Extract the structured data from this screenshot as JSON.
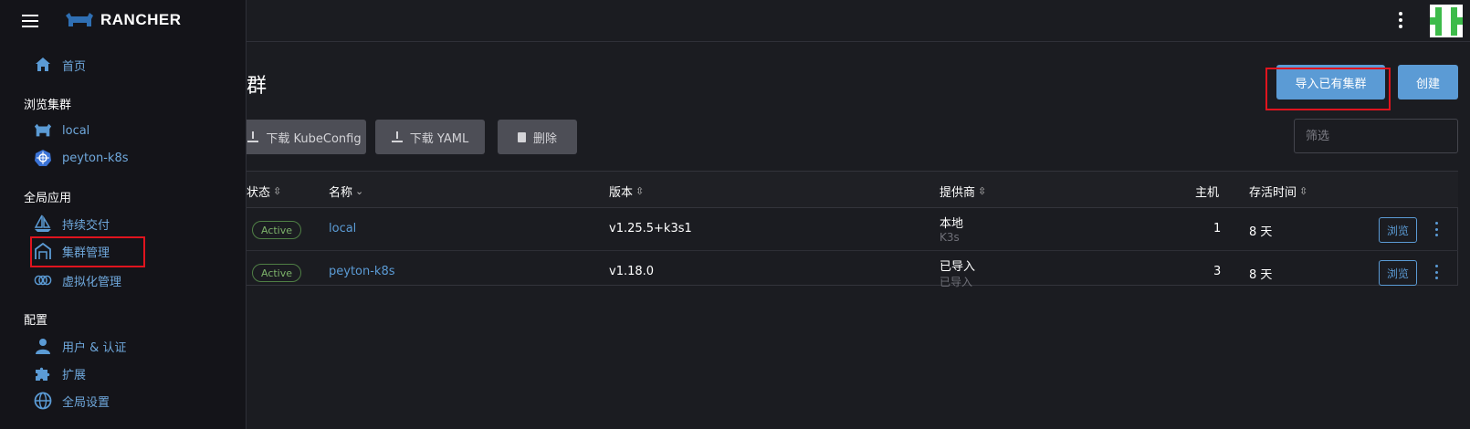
{
  "brand": {
    "logo_text": "RANCHER"
  },
  "sidebar": {
    "home": "首页",
    "groups": [
      {
        "label": "浏览集群",
        "items": [
          "local",
          "peyton-k8s"
        ]
      },
      {
        "label": "全局应用",
        "items": [
          "持续交付",
          "集群管理",
          "虚拟化管理"
        ]
      },
      {
        "label": "配置",
        "items": [
          "用户 & 认证",
          "扩展",
          "全局设置"
        ]
      }
    ]
  },
  "page": {
    "title": "群",
    "import_button": "导入已有集群",
    "create_button": "创建",
    "toolbar": {
      "kubeconfig": "下载 KubeConfig",
      "yaml": "下载 YAML",
      "delete": "删除"
    },
    "filter_placeholder": "筛选"
  },
  "table": {
    "columns": [
      "状态",
      "名称",
      "版本",
      "提供商",
      "主机",
      "存活时间"
    ],
    "rows": [
      {
        "status": "Active",
        "name": "local",
        "version": "v1.25.5+k3s1",
        "provider": "本地",
        "provider_sub": "K3s",
        "hosts": "1",
        "age": "8 天",
        "action": "浏览"
      },
      {
        "status": "Active",
        "name": "peyton-k8s",
        "version": "v1.18.0",
        "provider": "已导入",
        "provider_sub": "已导入",
        "hosts": "3",
        "age": "8 天",
        "action": "浏览"
      }
    ]
  },
  "colors": {
    "accent": "#5b9bd5",
    "active": "#7db36a",
    "highlight": "#e0141e"
  }
}
